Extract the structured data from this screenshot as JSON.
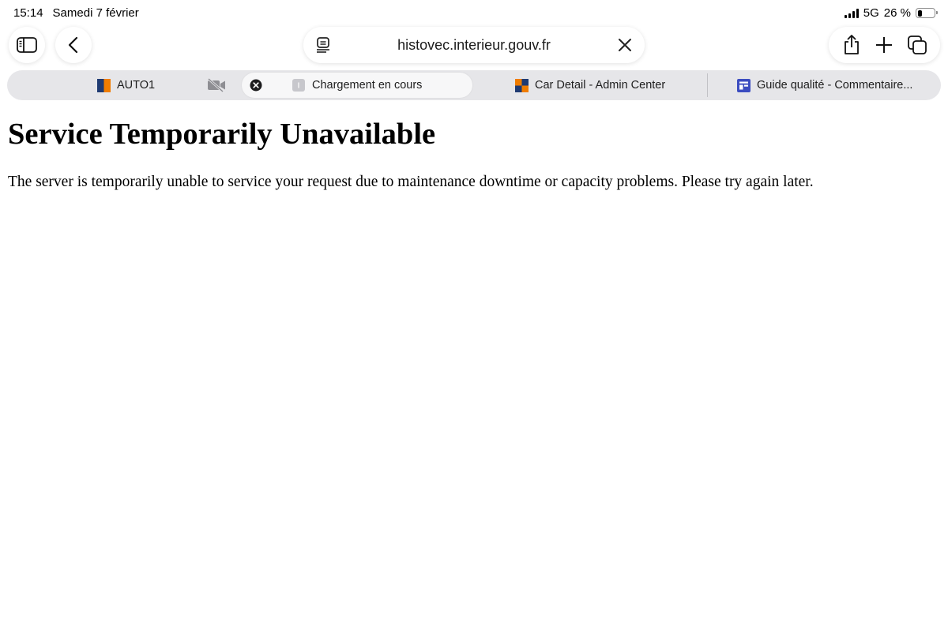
{
  "status_bar": {
    "time": "15:14",
    "date": "Samedi 7 février",
    "network": "5G",
    "battery_percent": "26 %",
    "battery_level": 0.26
  },
  "toolbar": {
    "sidebar_icon": "sidebar-icon",
    "back_icon": "chevron-left-icon",
    "url": "histovec.interieur.gouv.fr",
    "reader_icon": "reader-icon",
    "stop_icon": "close-icon",
    "share_icon": "share-icon",
    "new_tab_icon": "plus-icon",
    "tabs_icon": "tabs-overview-icon"
  },
  "tabs": [
    {
      "title": "AUTO1",
      "favicon_colors": [
        "#1f3b73",
        "#f07d00"
      ]
    },
    {
      "title": "Chargement en cours",
      "active": true
    },
    {
      "title": "Car Detail - Admin Center",
      "favicon_colors": [
        "#f07d00",
        "#1f3b73"
      ]
    },
    {
      "title": "Guide qualité - Commentaire...",
      "favicon_color": "#3b4cc0"
    }
  ],
  "page": {
    "heading": "Service Temporarily Unavailable",
    "message": "The server is temporarily unable to service your request due to maintenance downtime or capacity problems. Please try again later."
  }
}
